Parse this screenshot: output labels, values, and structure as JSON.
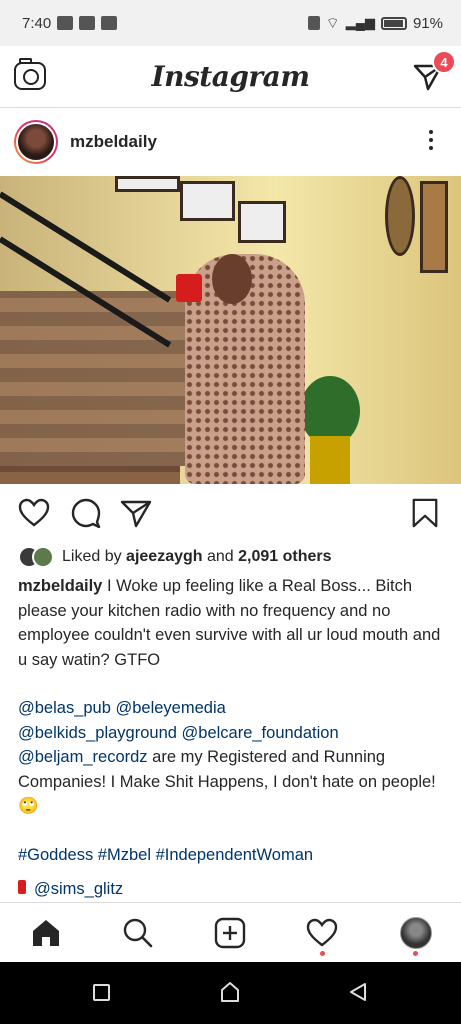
{
  "status": {
    "time": "7:40",
    "battery": "91%"
  },
  "header": {
    "logo": "Instagram",
    "dm_badge": "4"
  },
  "post": {
    "username": "mzbeldaily",
    "likes": {
      "prefix": "Liked by ",
      "user": "ajeezaygh",
      "middle": " and ",
      "count": "2,091 others"
    },
    "caption": {
      "username": "mzbeldaily",
      "text": "I Woke up feeling like a Real Boss... Bitch please your kitchen radio with no frequency and no employee couldn't even survive with all ur loud mouth and u say watin? GTFO",
      "mentions_1": "@belas_pub @beleyemedia",
      "mentions_2": "@belkids_playground @belcare_foundation",
      "mentions_3": "@beljam_recordz",
      "text_2": " are my Registered and Running Companies! I Make Shit Happens, I don't hate on people!🙄",
      "hashtags": "#Goddess #Mzbel #IndependentWoman",
      "cut_mention": "@sims_glitz"
    }
  },
  "icons": {
    "camera": "camera-icon",
    "direct": "direct-message-icon",
    "more": "more-options-icon",
    "like": "heart-icon",
    "comment": "comment-icon",
    "share": "share-icon",
    "save": "bookmark-icon",
    "home": "home-icon",
    "search": "search-icon",
    "add": "add-post-icon",
    "activity": "activity-heart-icon",
    "profile": "profile-avatar-icon"
  },
  "colors": {
    "badge": "#ed4956",
    "link": "#003569",
    "text": "#262626"
  }
}
